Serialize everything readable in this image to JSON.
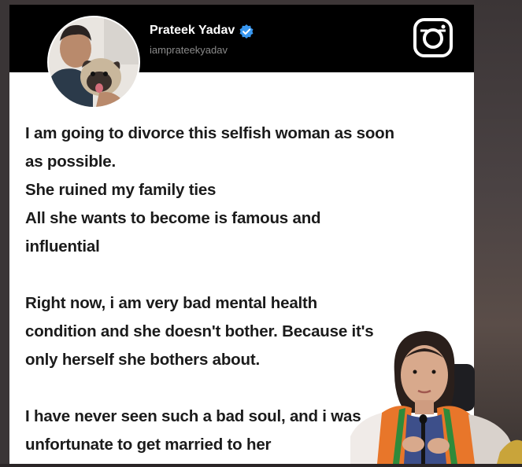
{
  "profile": {
    "name": "Prateek Yadav",
    "handle": "iamprateekyadav"
  },
  "post": {
    "lines": [
      "I am going to divorce this selfish woman as soon",
      "as possible.",
      "She ruined my family ties",
      "All she wants to become is famous and",
      "influential",
      "",
      "Right now, i am very bad mental health",
      "condition and she doesn't bother. Because it's",
      "only herself she bothers about.",
      "",
      "I have never seen such a bad soul, and i was",
      "unfortunate to get married to her"
    ]
  },
  "icons": {
    "verified": "verified-badge-icon",
    "platform": "instagram-icon"
  },
  "colors": {
    "header_bg": "#000000",
    "verified_blue": "#3897f0"
  }
}
